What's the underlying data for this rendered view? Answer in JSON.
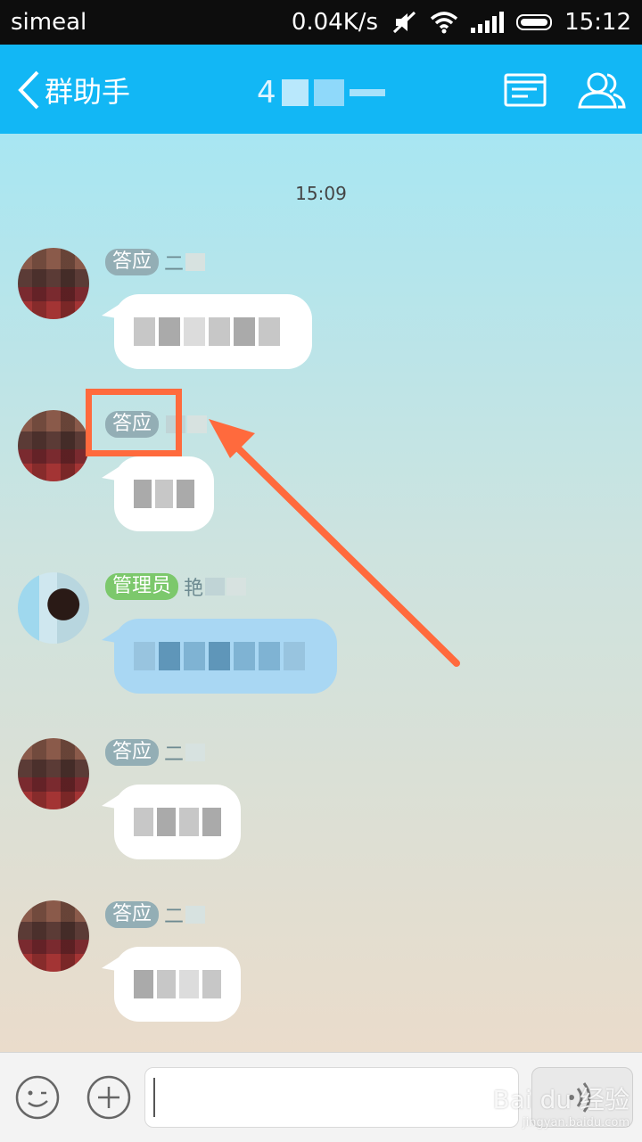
{
  "status_bar": {
    "carrier": "simeal",
    "speed": "0.04K/s",
    "time": "15:12"
  },
  "title_bar": {
    "back_label": "群助手",
    "group_title_prefix": "4"
  },
  "chat": {
    "timestamp": "15:09",
    "messages": [
      {
        "badge": "答应",
        "nick_char": "二"
      },
      {
        "badge": "答应",
        "nick_char": ""
      },
      {
        "badge": "管理员",
        "nick_char": "艳"
      },
      {
        "badge": "答应",
        "nick_char": "二"
      },
      {
        "badge": "答应",
        "nick_char": "二"
      }
    ]
  },
  "colors": {
    "accent": "#12b7f5",
    "annotation": "#ff6a3d",
    "admin_badge": "#7cc86c",
    "member_badge": "#93aeb5"
  },
  "icons": [
    "chevron-left-icon",
    "group-info-icon",
    "group-members-icon",
    "emoji-icon",
    "plus-icon",
    "voice-icon"
  ],
  "input_bar": {
    "placeholder": ""
  },
  "watermark": {
    "brand": "Bai du 经验",
    "url": "jingyan.baidu.com"
  }
}
